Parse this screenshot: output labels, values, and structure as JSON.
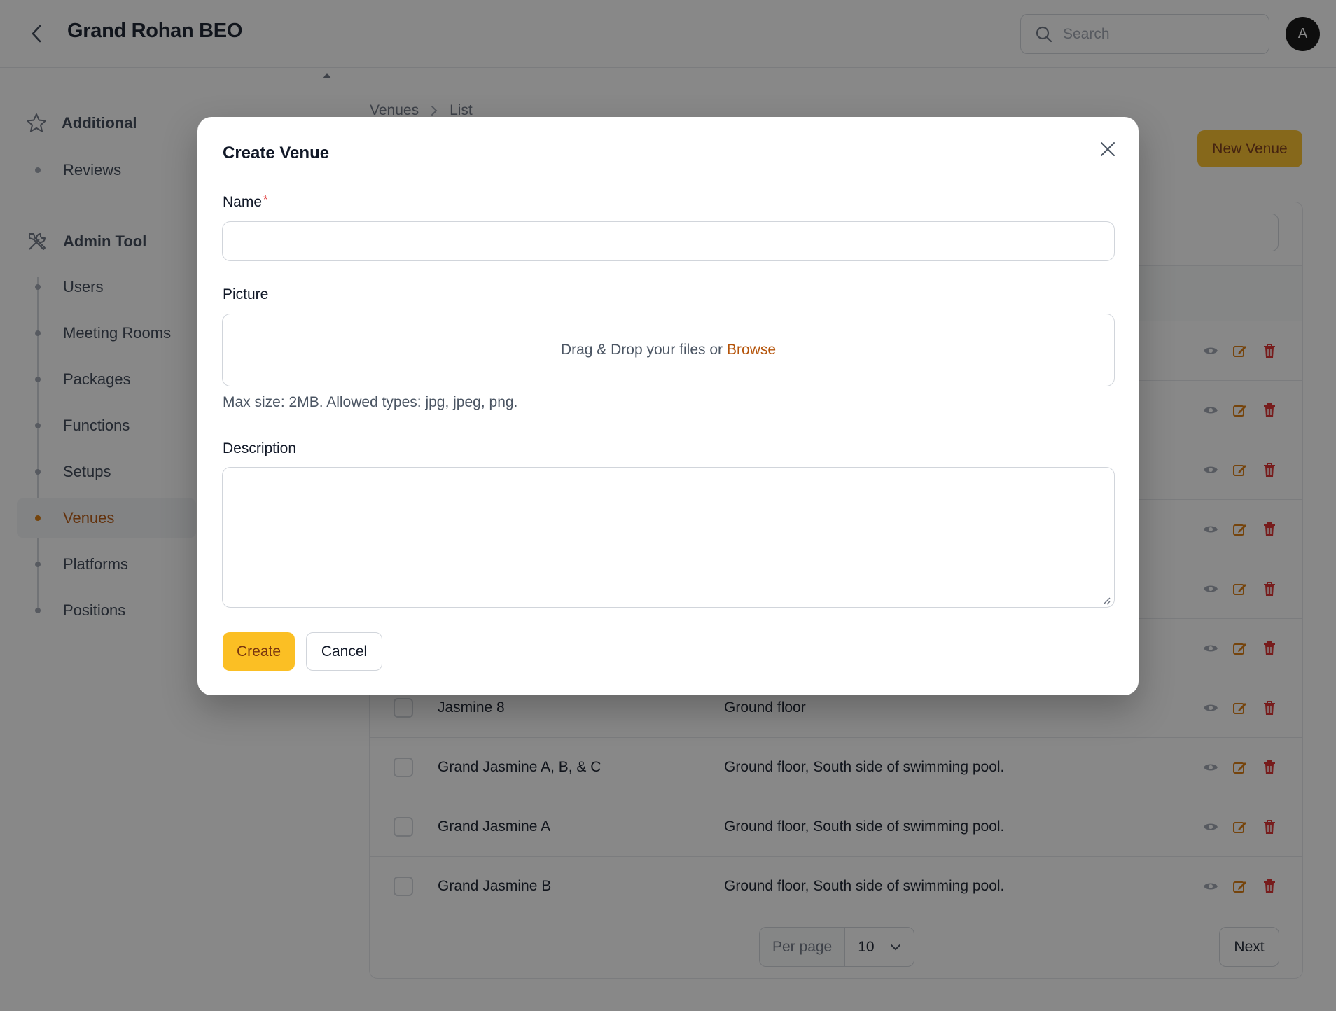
{
  "header": {
    "title": "Grand Rohan BEO",
    "search_placeholder": "Search",
    "avatar_initial": "A"
  },
  "sidebar": {
    "groups": [
      {
        "label": "Additional",
        "icon": "star-icon",
        "items": [
          {
            "label": "Reviews"
          }
        ]
      },
      {
        "label": "Admin Tool",
        "icon": "tools-icon",
        "items": [
          {
            "label": "Users"
          },
          {
            "label": "Meeting Rooms"
          },
          {
            "label": "Packages"
          },
          {
            "label": "Functions"
          },
          {
            "label": "Setups"
          },
          {
            "label": "Venues",
            "active": true
          },
          {
            "label": "Platforms"
          },
          {
            "label": "Positions"
          }
        ]
      }
    ]
  },
  "main": {
    "breadcrumb": [
      "Venues",
      "List"
    ],
    "new_button": "New Venue",
    "table": {
      "rows": [
        {
          "name": "",
          "location": ""
        },
        {
          "name": "",
          "location": ""
        },
        {
          "name": "",
          "location": ""
        },
        {
          "name": "",
          "location": ""
        },
        {
          "name": "",
          "location": ""
        },
        {
          "name": "",
          "location": ""
        },
        {
          "name": "Jasmine 8",
          "location": "Ground floor"
        },
        {
          "name": "Grand Jasmine A, B, & C",
          "location": "Ground floor, South side of swimming pool."
        },
        {
          "name": "Grand Jasmine A",
          "location": "Ground floor, South side of swimming pool."
        },
        {
          "name": "Grand Jasmine B",
          "location": "Ground floor, South side of swimming pool."
        }
      ]
    },
    "pagination": {
      "per_page_label": "Per page",
      "per_page_value": "10",
      "next_label": "Next"
    }
  },
  "modal": {
    "title": "Create Venue",
    "name_label": "Name",
    "name_required_mark": "*",
    "name_value": "",
    "picture_label": "Picture",
    "dropzone_text": "Drag & Drop your files or",
    "dropzone_browse": "Browse",
    "picture_hint": "Max size: 2MB. Allowed types: jpg, jpeg, png.",
    "description_label": "Description",
    "description_value": "",
    "create_label": "Create",
    "cancel_label": "Cancel"
  },
  "colors": {
    "accent": "#fbbf24",
    "accent_text": "#b45309",
    "danger": "#dc2626",
    "overlay": "rgba(17,17,17,0.5)"
  }
}
